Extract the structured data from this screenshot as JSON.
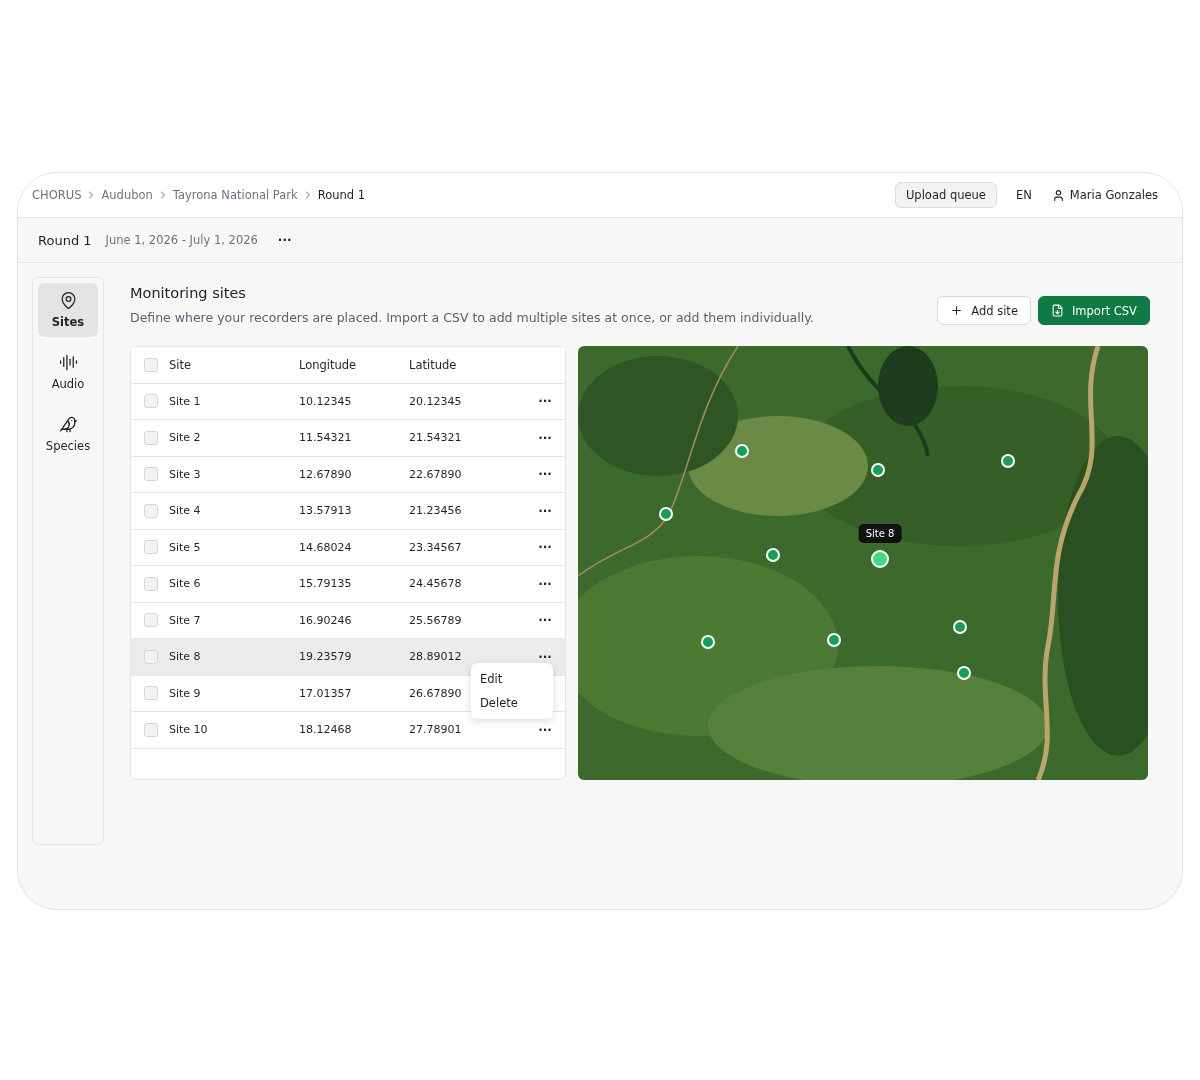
{
  "breadcrumbs": [
    {
      "label": "CHORUS",
      "current": false
    },
    {
      "label": "Audubon",
      "current": false
    },
    {
      "label": "Tayrona National Park",
      "current": false
    },
    {
      "label": "Round 1",
      "current": true
    }
  ],
  "header": {
    "upload_button": "Upload queue",
    "language": "EN",
    "user": "Maria Gonzales"
  },
  "round": {
    "title": "Round 1",
    "dates": "June 1, 2026 - July 1, 2026",
    "menu": "···"
  },
  "sidebar": {
    "items": [
      {
        "label": "Sites",
        "kind": "pin",
        "selected": true
      },
      {
        "label": "Audio",
        "kind": "wave",
        "selected": false
      },
      {
        "label": "Species",
        "kind": "bird",
        "selected": false
      }
    ]
  },
  "section": {
    "title": "Monitoring sites",
    "description": "Define where your recorders are placed. Import a CSV to add multiple sites at once, or add them individually.",
    "add_button": "Add site",
    "import_button": "Import CSV"
  },
  "table": {
    "columns": [
      "Site",
      "Longitude",
      "Latitude"
    ],
    "all_checked": false,
    "rows": [
      {
        "site": "Site 1",
        "longitude": "10.12345",
        "latitude": "20.12345",
        "checked": false,
        "highlighted": false,
        "menu": "···"
      },
      {
        "site": "Site 2",
        "longitude": "11.54321",
        "latitude": "21.54321",
        "checked": false,
        "highlighted": false,
        "menu": "···"
      },
      {
        "site": "Site 3",
        "longitude": "12.67890",
        "latitude": "22.67890",
        "checked": false,
        "highlighted": false,
        "menu": "···"
      },
      {
        "site": "Site 4",
        "longitude": "13.57913",
        "latitude": "21.23456",
        "checked": false,
        "highlighted": false,
        "menu": "···"
      },
      {
        "site": "Site 5",
        "longitude": "14.68024",
        "latitude": "23.34567",
        "checked": false,
        "highlighted": false,
        "menu": "···"
      },
      {
        "site": "Site 6",
        "longitude": "15.79135",
        "latitude": "24.45678",
        "checked": false,
        "highlighted": false,
        "menu": "···"
      },
      {
        "site": "Site 7",
        "longitude": "16.90246",
        "latitude": "25.56789",
        "checked": false,
        "highlighted": false,
        "menu": "···"
      },
      {
        "site": "Site 8",
        "longitude": "19.23579",
        "latitude": "28.89012",
        "checked": false,
        "highlighted": true,
        "menu": "···"
      },
      {
        "site": "Site 9",
        "longitude": "17.01357",
        "latitude": "26.67890",
        "checked": false,
        "highlighted": false
      },
      {
        "site": "Site 10",
        "longitude": "18.12468",
        "latitude": "27.78901",
        "checked": false,
        "highlighted": false,
        "menu": "···"
      }
    ],
    "context_menu": [
      "Edit",
      "Delete"
    ]
  },
  "map": {
    "kind": "picture",
    "pins": [
      {
        "selected": false
      },
      {
        "selected": false
      },
      {
        "selected": false
      },
      {
        "selected": false
      },
      {
        "selected": false
      },
      {
        "selected": true,
        "tooltip": "Site 8"
      },
      {
        "selected": false
      },
      {
        "selected": false
      },
      {
        "selected": false
      },
      {
        "selected": false
      }
    ]
  }
}
